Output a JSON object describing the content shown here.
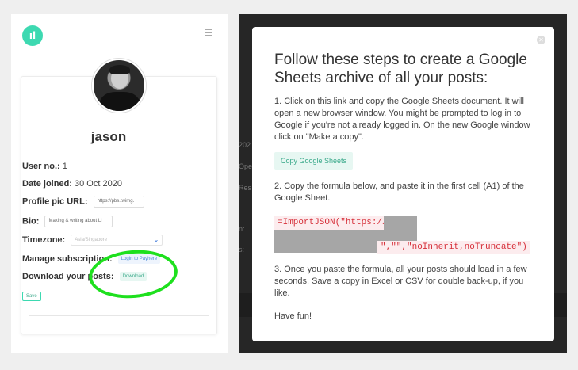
{
  "left": {
    "logo_text": "ıl",
    "username": "jason",
    "user_no_label": "User no.:",
    "user_no_value": "1",
    "date_joined_label": "Date joined:",
    "date_joined_value": "30 Oct 2020",
    "profile_pic_label": "Profile pic URL:",
    "profile_pic_value": "https://pbs.twimg.",
    "bio_label": "Bio:",
    "bio_value": "Making & writing about Li",
    "timezone_label": "Timezone:",
    "timezone_value": "Asia/Singapore",
    "subscription_label": "Manage subscription:",
    "subscription_link": "Login to Payhere",
    "download_label": "Download your posts:",
    "download_button": "Download",
    "save_button": "Save"
  },
  "background": {
    "fragments": [
      "202",
      "Ope",
      "Res",
      "n:",
      "s:"
    ]
  },
  "modal": {
    "title": "Follow these steps to create a Google Sheets archive of all your posts:",
    "step1": "1. Click on this link and copy the Google Sheets document. It will open a new browser window. You might be prompted to log in to Google if you're not already logged in. On the new Google window click on \"Make a copy\".",
    "copy_button": "Copy Google Sheets",
    "step2": "2. Copy the formula below, and paste it in the first cell (A1) of the Google Sheet.",
    "code_start": "=ImportJSON(\"https://",
    "code_end": "\",\"\",\"noInherit,noTruncate\")",
    "step3": "3. Once you paste the formula, all your posts should load in a few seconds. Save a copy in Excel or CSV for double back-up, if you like.",
    "closing": "Have fun!"
  },
  "colors": {
    "accent": "#3dd9b1",
    "highlight_circle": "#1ee01e",
    "code_red": "#d6303a"
  }
}
